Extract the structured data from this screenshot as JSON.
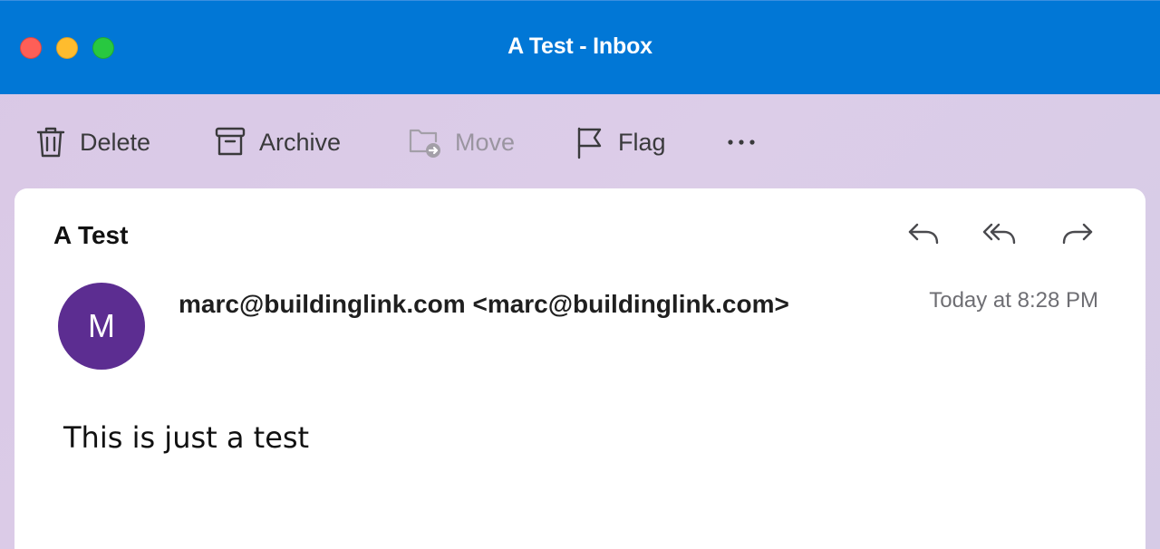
{
  "window": {
    "title": "A Test - Inbox"
  },
  "toolbar": {
    "delete_label": "Delete",
    "archive_label": "Archive",
    "move_label": "Move",
    "flag_label": "Flag",
    "more_icon": "ellipsis-icon"
  },
  "message": {
    "subject": "A Test",
    "avatar_initial": "M",
    "sender": "marc@buildinglink.com <marc@buildinglink.com>",
    "time": "Today at 8:28 PM",
    "body": "This is just a test"
  },
  "colors": {
    "titlebar": "#0177d6",
    "avatar": "#5c2d91",
    "close": "#fe5f57",
    "minimize": "#febc2e",
    "maximize": "#28c840"
  }
}
